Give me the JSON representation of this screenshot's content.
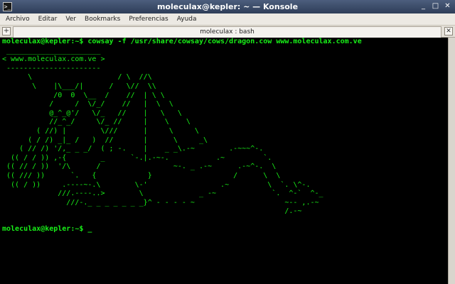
{
  "window": {
    "title": "moleculax@kepler: ~ — Konsole",
    "icon": "konsole-icon",
    "buttons": [
      "minimize-icon",
      "maximize-icon",
      "close-icon"
    ]
  },
  "menubar": {
    "items": [
      "Archivo",
      "Editar",
      "Ver",
      "Bookmarks",
      "Preferencias",
      "Ayuda"
    ]
  },
  "tabs": [
    {
      "label": "moleculax : bash"
    }
  ],
  "terminal": {
    "prompt_line": "moleculax@kepler:~$ cowsay -f /usr/share/cowsay/cows/dragon.cow www.moleculax.com.ve",
    "output": [
      " ______________________",
      "< www.moleculax.com.ve >",
      " ----------------------",
      "      \\                    / \\  //\\",
      "       \\    |\\___/|      /   \\//  \\\\",
      "            /0  0  \\__  /    //  | \\ \\",
      "           /     /  \\/_/    //   |  \\  \\",
      "           @_^_@'/   \\/_   //    |   \\   \\",
      "           //_^_/     \\/_ //     |    \\    \\",
      "        ( //) |        \\///      |     \\     \\",
      "      ( / /) _|_ /   )  //       |      \\     _\\",
      "    ( // /) '/,_ _ _/  ( ; -.    |    _ _\\.-~        .-~~~^-.",
      "  (( / / )) ,-{        _      `-.|.-~-.           .~         `.",
      " (( // / ))  '/\\      /                 ~-. _ .-~      .-~^-.  \\",
      " (( /// ))      `.   {            }                   /      \\  \\",
      "  (( / ))     .----~-.\\        \\-'                 .~         \\  `. \\^-.",
      "             ///.----..>        \\             _ -~             `.  ^-`  ^-_",
      "               ///-._ _ _ _ _ _ _}^ - - - - ~                     ~-- ,.-~",
      "                                                                  /.-~"
    ],
    "final_prompt": "moleculax@kepler:~$ _"
  },
  "colors": {
    "terminal_fg": "#18f018",
    "terminal_bg": "#000000",
    "titlebar": "#3a4a68"
  }
}
